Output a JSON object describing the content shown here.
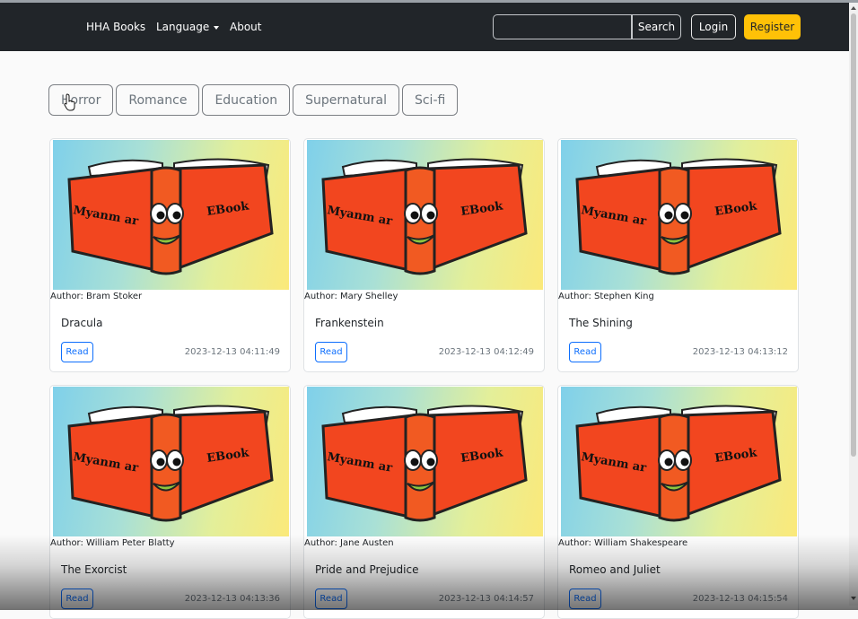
{
  "navbar": {
    "brand": "HHA Books",
    "language_label": "Language",
    "about_label": "About",
    "search": {
      "value": "",
      "placeholder": ""
    },
    "search_label": "Search",
    "login_label": "Login",
    "register_label": "Register"
  },
  "categories": [
    "Horror",
    "Romance",
    "Education",
    "Supernatural",
    "Sci-fi"
  ],
  "cover": {
    "left_text": "Myanm ar",
    "right_text": "EBook"
  },
  "books": [
    {
      "author": "Author: Bram Stoker",
      "title": "Dracula",
      "read_label": "Read",
      "date": "2023-12-13 04:11:49"
    },
    {
      "author": "Author: Mary Shelley",
      "title": "Frankenstein",
      "read_label": "Read",
      "date": "2023-12-13 04:12:49"
    },
    {
      "author": "Author: Stephen King",
      "title": "The Shining",
      "read_label": "Read",
      "date": "2023-12-13 04:13:12"
    },
    {
      "author": "Author: William Peter Blatty",
      "title": "The Exorcist",
      "read_label": "Read",
      "date": "2023-12-13 04:13:36"
    },
    {
      "author": "Author: Jane Austen",
      "title": "Pride and Prejudice",
      "read_label": "Read",
      "date": "2023-12-13 04:14:57"
    },
    {
      "author": "Author: William Shakespeare",
      "title": "Romeo and Juliet",
      "read_label": "Read",
      "date": "2023-12-13 04:15:54"
    }
  ],
  "colors": {
    "navbar": "#212529",
    "accent_register": "#ffc107",
    "read_button": "#0d6efd",
    "cover_book": "#f2461f"
  },
  "icons": {
    "cursor": "pointer-cursor-icon",
    "language_caret": "caret-down-icon"
  }
}
